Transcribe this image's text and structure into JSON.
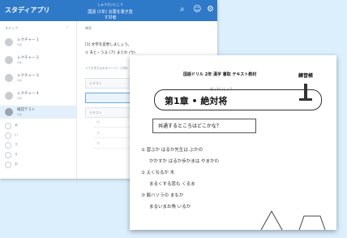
{
  "app": {
    "title": "スタディアプリ",
    "header_sub": "しゅうだいにこう",
    "header_title": "国語 (1年) 言葉を書き直す対者",
    "icons": [
      "search-icon",
      "people-icon",
      "settings-icon"
    ]
  },
  "sidebar": {
    "heading": "ステップ",
    "items": [
      {
        "label": "レクチャー 1",
        "sub": "対象"
      },
      {
        "label": "レクチャー 2",
        "sub": "対象"
      },
      {
        "label": "レクチャー 3",
        "sub": "対象"
      },
      {
        "label": "レクチャー 4",
        "sub": "対象"
      },
      {
        "label": "確認テスト",
        "sub": "対象",
        "active": true
      }
    ],
    "small_items": [
      "あ",
      "い",
      "う",
      "え",
      "お"
    ]
  },
  "content": {
    "heading": "練習",
    "line1": "[1] 文字を変更しましょう。",
    "line2": "① あと・うる (ア) まえわ (ウ)",
    "section": "メモを書き込めるペーパー (付録)",
    "field_placeholder": "テキスト",
    "rows": [
      "ウ",
      "イ",
      "ウ"
    ]
  },
  "paper": {
    "header": "国語ドリル 2年 漢字 書取 テキスト教材",
    "right_label": "練習帳",
    "title": "第1章 • 絶対将",
    "ruby": "ぜったいしょう",
    "question": "共通するところはどこかな？",
    "lines": [
      "① 習ぶか はるか先生は ぶかの",
      "かかすか はるか歩かまは やまかわ",
      "② えくなるか 木",
      "まるくする窓も くるま",
      "③ 飯ハソラの まもか",
      "まるいまお角 いるか"
    ]
  }
}
